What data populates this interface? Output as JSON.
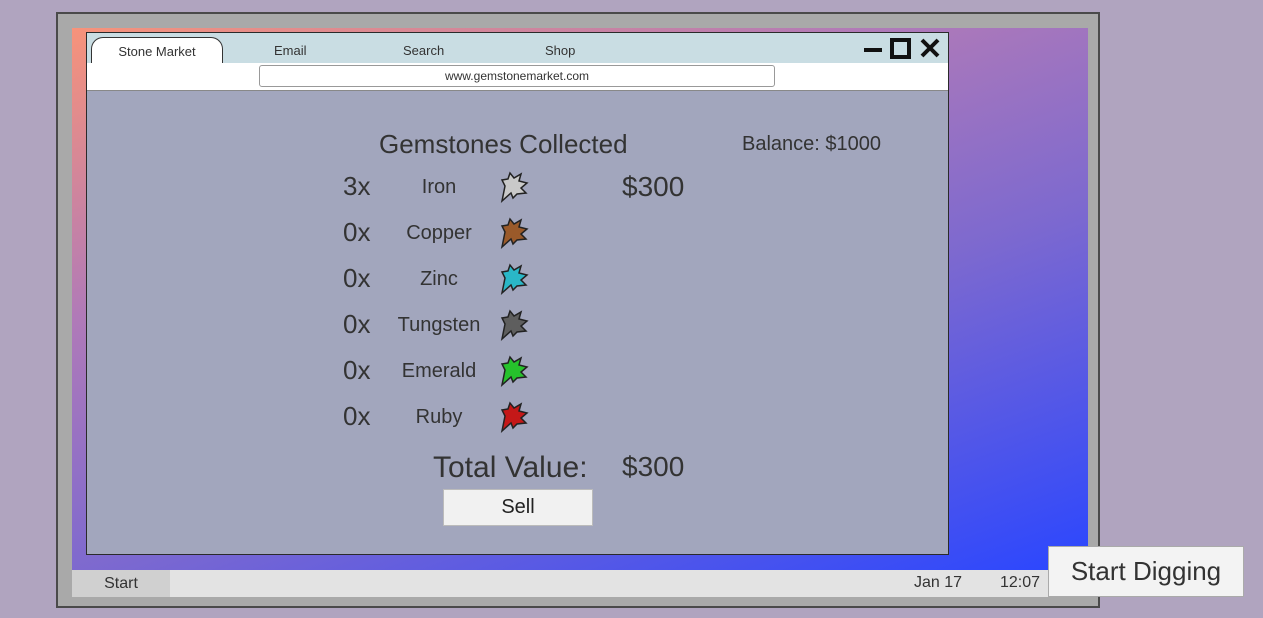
{
  "browser": {
    "tabs": [
      {
        "label": "Stone Market"
      },
      {
        "label": "Email"
      },
      {
        "label": "Search"
      },
      {
        "label": "Shop"
      }
    ],
    "url": "www.gemstonemarket.com"
  },
  "market": {
    "title": "Gemstones Collected",
    "balance": "Balance: $1000",
    "gems": [
      {
        "qty": "3x",
        "name": "Iron",
        "color": "#c9c9c9",
        "price": "$300"
      },
      {
        "qty": "0x",
        "name": "Copper",
        "color": "#9a5a2a",
        "price": ""
      },
      {
        "qty": "0x",
        "name": "Zinc",
        "color": "#2ab7c7",
        "price": ""
      },
      {
        "qty": "0x",
        "name": "Tungsten",
        "color": "#5e5e5e",
        "price": ""
      },
      {
        "qty": "0x",
        "name": "Emerald",
        "color": "#26c22c",
        "price": ""
      },
      {
        "qty": "0x",
        "name": "Ruby",
        "color": "#c41818",
        "price": ""
      }
    ],
    "total_label": "Total Value:",
    "total_value": "$300",
    "sell_label": "Sell"
  },
  "taskbar": {
    "start_label": "Start",
    "date": "Jan 17",
    "time": "12:07"
  },
  "start_digging_label": "Start Digging"
}
